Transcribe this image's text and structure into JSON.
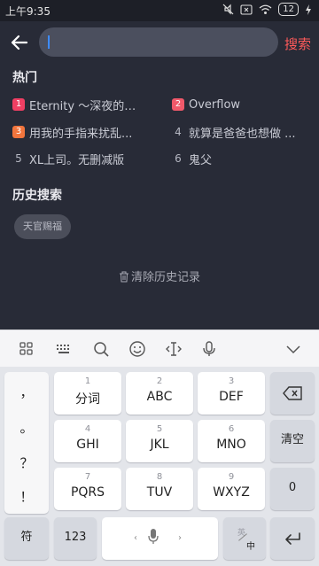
{
  "status": {
    "time": "上午9:35",
    "battery": "12"
  },
  "search": {
    "placeholder": "",
    "button": "搜索"
  },
  "hot": {
    "title": "热门",
    "items": [
      {
        "rank": "1",
        "text": "Eternity ～深夜的濡..."
      },
      {
        "rank": "2",
        "text": "Overflow"
      },
      {
        "rank": "3",
        "text": "用我的手指来扰乱..."
      },
      {
        "rank": "4",
        "text": "就算是爸爸也想做 ..."
      },
      {
        "rank": "5",
        "text": "XL上司。无删减版"
      },
      {
        "rank": "6",
        "text": "鬼父"
      }
    ]
  },
  "history": {
    "title": "历史搜索",
    "chips": [
      "天官赐福"
    ],
    "clear": "清除历史记录"
  },
  "keyboard": {
    "punct": [
      "，",
      "。",
      "？",
      "！"
    ],
    "keys": [
      {
        "num": "1",
        "label": "分词"
      },
      {
        "num": "2",
        "label": "ABC"
      },
      {
        "num": "3",
        "label": "DEF"
      },
      {
        "num": "4",
        "label": "GHI"
      },
      {
        "num": "5",
        "label": "JKL"
      },
      {
        "num": "6",
        "label": "MNO"
      },
      {
        "num": "7",
        "label": "PQRS"
      },
      {
        "num": "8",
        "label": "TUV"
      },
      {
        "num": "9",
        "label": "WXYZ"
      }
    ],
    "clear": "清空",
    "zero": "0",
    "symbol": "符",
    "numbers": "123",
    "zh_top": "英",
    "zh_bottom": "中"
  }
}
